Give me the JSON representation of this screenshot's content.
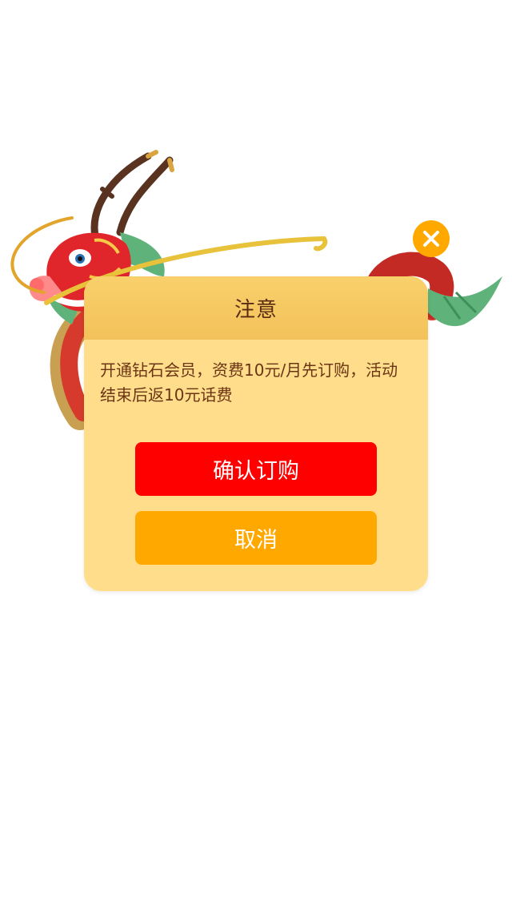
{
  "dialog": {
    "title": "注意",
    "message": "开通钻石会员，资费10元/月先订购，活动结束后返10元话费",
    "confirm_label": "确认订购",
    "cancel_label": "取消"
  },
  "icons": {
    "close": "close-icon",
    "decoration": "dragon-illustration"
  },
  "colors": {
    "dialog_background": "#ffdd8a",
    "header_background": "#f4c25a",
    "title_text": "#5a2b13",
    "message_text": "#6b3515",
    "confirm_button": "#ff0000",
    "cancel_button": "#ffa800",
    "close_button": "#ffa800"
  }
}
